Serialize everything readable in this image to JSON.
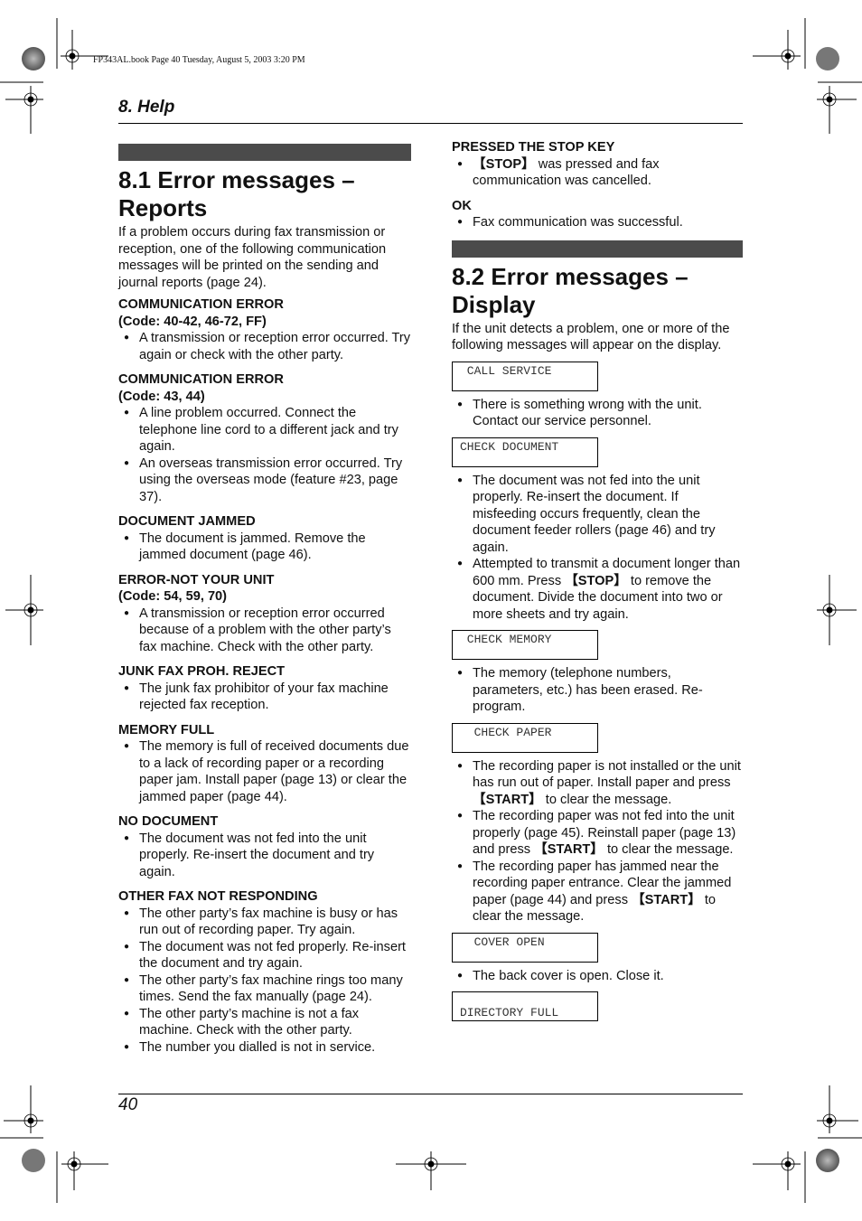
{
  "imprint": "FP343AL.book  Page 40  Tuesday, August 5, 2003  3:20 PM",
  "running_head": "8. Help",
  "page_number": "40",
  "section1": {
    "title": "8.1 Error messages – Reports",
    "intro": "If a problem occurs during fax transmission or reception, one of the following communication messages will be printed on the sending and journal reports (page 24).",
    "entries": [
      {
        "title": "COMMUNICATION ERROR",
        "subtitle": "(Code: 40-42, 46-72, FF)",
        "bullets": [
          "A transmission or reception error occurred. Try again or check with the other party."
        ]
      },
      {
        "title": "COMMUNICATION ERROR",
        "subtitle": "(Code: 43, 44)",
        "bullets": [
          "A line problem occurred. Connect the telephone line cord to a different jack and try again.",
          "An overseas transmission error occurred. Try using the overseas mode (feature #23, page 37)."
        ]
      },
      {
        "title": "DOCUMENT JAMMED",
        "bullets": [
          "The document is jammed. Remove the jammed document (page 46)."
        ]
      },
      {
        "title": "ERROR-NOT YOUR UNIT",
        "subtitle": "(Code: 54, 59, 70)",
        "bullets": [
          "A transmission or reception error occurred because of a problem with the other party’s fax machine. Check with the other party."
        ]
      },
      {
        "title": "JUNK FAX PROH. REJECT",
        "bullets": [
          "The junk fax prohibitor of your fax machine rejected fax reception."
        ]
      },
      {
        "title": "MEMORY FULL",
        "bullets": [
          "The memory is full of received documents due to a lack of recording paper or a recording paper jam. Install paper (page 13) or clear the jammed paper (page 44)."
        ]
      },
      {
        "title": "NO DOCUMENT",
        "bullets": [
          "The document was not fed into the unit properly. Re-insert the document and try again."
        ]
      },
      {
        "title": "OTHER FAX NOT RESPONDING",
        "bullets": [
          "The other party’s fax machine is busy or has run out of recording paper. Try again.",
          "The document was not fed properly. Re-insert the document and try again.",
          "The other party’s fax machine rings too many times. Send the fax manually (page 24).",
          "The other party’s machine is not a fax machine. Check with the other party.",
          "The number you dialled is not in service."
        ]
      }
    ]
  },
  "section1_cont": [
    {
      "title": "PRESSED THE STOP KEY",
      "bullets": [
        {
          "key": "【STOP】",
          "text": " was pressed and fax communication was cancelled."
        }
      ]
    },
    {
      "title": "OK",
      "bullets": [
        {
          "text": "Fax communication was successful."
        }
      ]
    }
  ],
  "section2": {
    "title": "8.2 Error messages – Display",
    "intro": "If the unit detects a problem, one or more of the following messages will appear on the display.",
    "displays": [
      {
        "lcd": " CALL SERVICE",
        "bullets": [
          "There is something wrong with the unit. Contact our service personnel."
        ]
      },
      {
        "lcd": "CHECK DOCUMENT",
        "bullets": [
          "The document was not fed into the unit properly. Re-insert the document. If misfeeding occurs frequently, clean the document feeder rollers (page 46) and try again.",
          "Attempted to transmit a document longer than 600 mm. Press 【STOP】 to remove the document. Divide the document into two or more sheets and try again."
        ]
      },
      {
        "lcd": " CHECK MEMORY",
        "bullets": [
          "The memory (telephone numbers, parameters, etc.) has been erased. Re-program."
        ]
      },
      {
        "lcd": "  CHECK PAPER",
        "bullets": [
          "The recording paper is not installed or the unit has run out of paper. Install paper and press 【START】 to clear the message.",
          "The recording paper was not fed into the unit properly (page 45). Reinstall paper (page 13) and press 【START】 to clear the message.",
          "The recording paper has jammed near the recording paper entrance. Clear the jammed paper (page 44) and press 【START】 to clear the message."
        ]
      },
      {
        "lcd": "  COVER OPEN",
        "bullets": [
          "The back cover is open. Close it."
        ]
      },
      {
        "lcd": "DIRECTORY FULL",
        "bullets": []
      }
    ]
  }
}
